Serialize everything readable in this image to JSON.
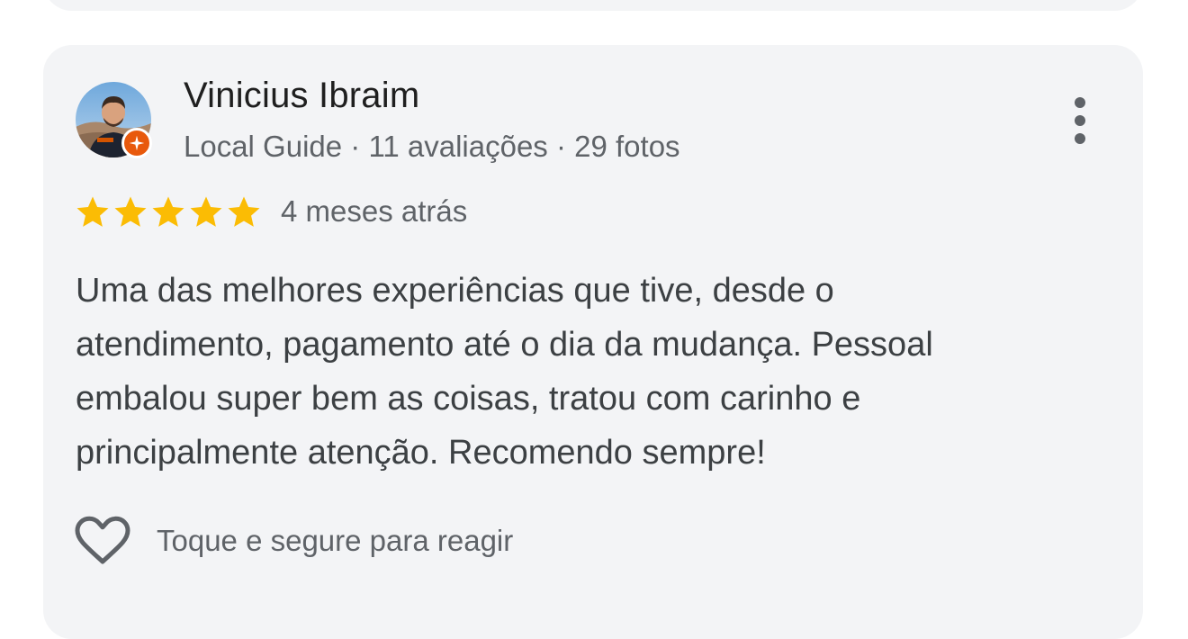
{
  "review": {
    "author_name": "Vinicius Ibraim",
    "author_meta": "Local Guide · 11 avaliações · 29 fotos",
    "rating": 5,
    "rating_max": 5,
    "date": "4 meses atrás",
    "text_lines": [
      "Uma das melhores experiências que tive, desde o",
      "atendimento, pagamento até o dia da mudança. Pessoal",
      "embalou super bem as coisas, tratou com carinho e",
      "principalmente atenção. Recomendo sempre!"
    ],
    "react_label": "Toque e segure para reagir"
  },
  "icons": {
    "more": "more-vert-icon",
    "star": "star-icon",
    "heart": "heart-outline-icon",
    "badge": "local-guide-badge-icon"
  },
  "colors": {
    "card_bg": "#f3f4f6",
    "star": "#fbbc04",
    "badge": "#e8590c",
    "secondary_text": "#5f6368"
  }
}
